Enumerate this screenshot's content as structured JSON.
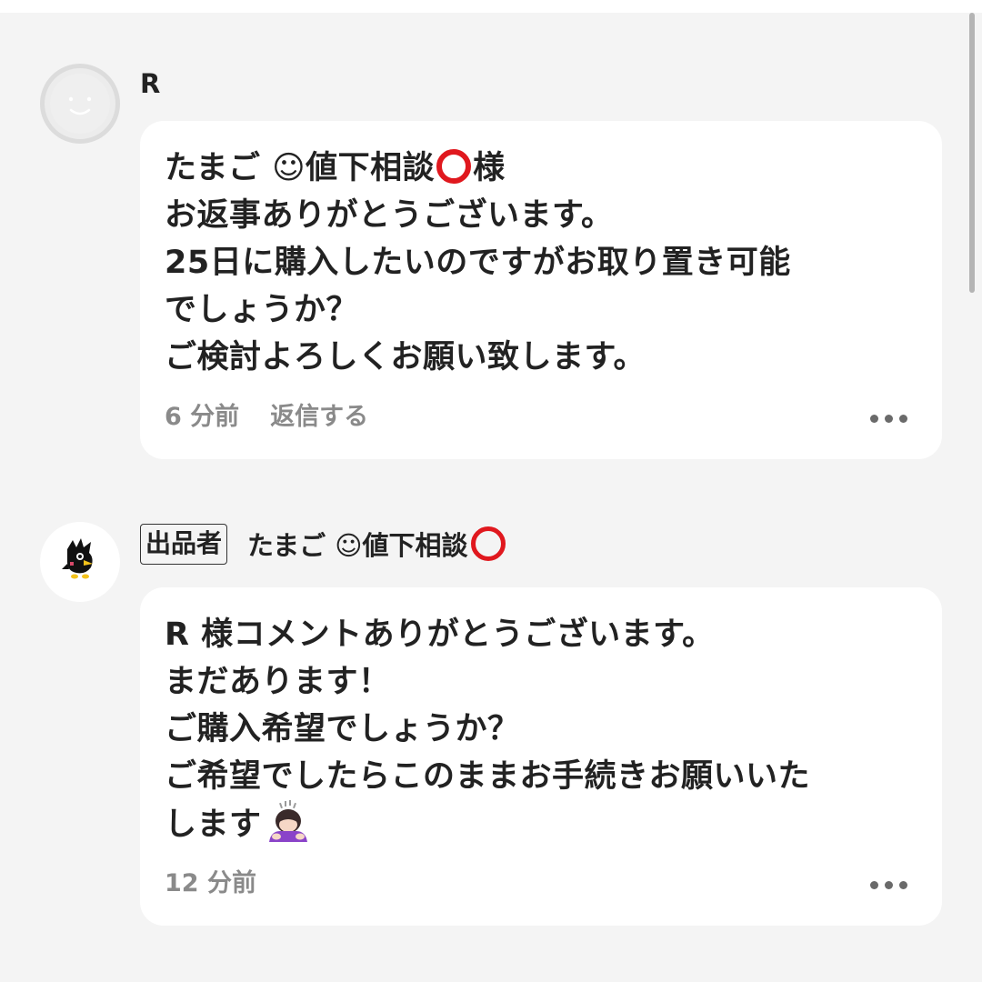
{
  "comments": [
    {
      "author": "R",
      "avatar_icon": "smiley-face-icon",
      "lines": [
        [
          "たまご ☺値下相談",
          "",
          "様"
        ],
        [
          "お返事ありがとうございます。"
        ],
        [
          "25日に購入したいのですがお取り置き可能"
        ],
        [
          "でしょうか？"
        ],
        [
          "ご検討よろしくお願い致します。"
        ]
      ],
      "time": "6 分前",
      "reply_label": "返信する",
      "more_icon": "more-horizontal-icon"
    },
    {
      "badge": "出品者",
      "author": "たまご ☺値下相談",
      "avatar_icon": "black-bird-character-icon",
      "lines": [
        [
          "R 様コメントありがとうございます。"
        ],
        [
          "まだあります！"
        ],
        [
          "ご購入希望でしょうか？"
        ],
        [
          "ご希望でしたらこのままお手続きお願いいた"
        ],
        [
          "します"
        ]
      ],
      "end_emoji": "person-bowing-emoji",
      "time": "12 分前",
      "more_icon": "more-horizontal-icon"
    }
  ],
  "colors": {
    "background": "#f4f4f4",
    "bubble": "#ffffff",
    "text": "#222222",
    "meta_text": "#8a8a8a",
    "red_circle": "#e0181e"
  },
  "inline_icons": {
    "red_circle": "heavy-large-circle-emoji"
  }
}
